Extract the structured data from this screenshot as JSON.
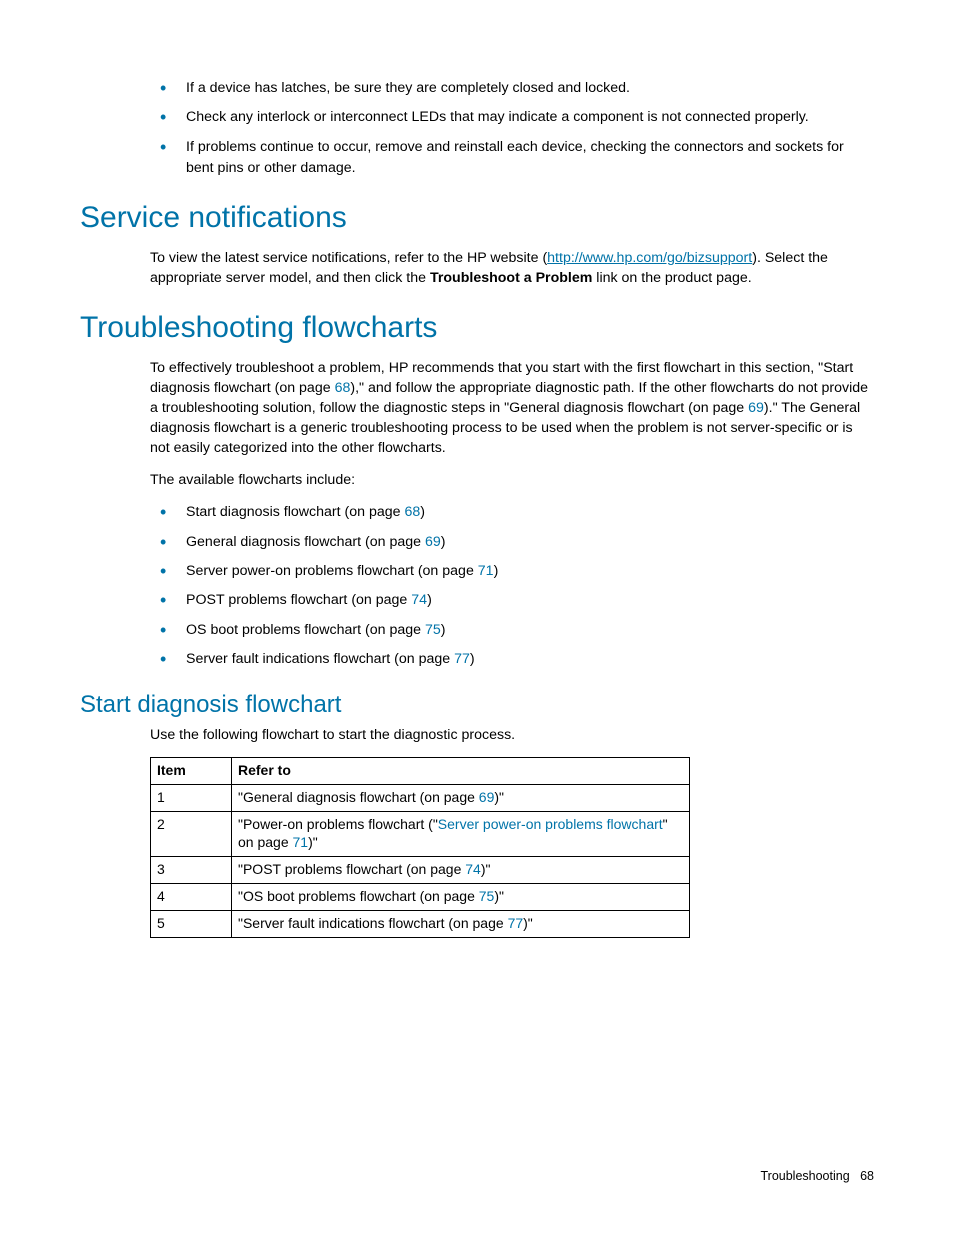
{
  "topBullets": [
    "If a device has latches, be sure they are completely closed and locked.",
    "Check any interlock or interconnect LEDs that may indicate a component is not connected properly.",
    "If problems continue to occur, remove and reinstall each device, checking the connectors and sockets for bent pins or other damage."
  ],
  "h1_service": "Service notifications",
  "service": {
    "pre": "To view the latest service notifications, refer to the HP website (",
    "link": "http://www.hp.com/go/bizsupport",
    "post1": "). Select the appropriate server model, and then click the ",
    "bold": "Troubleshoot a Problem",
    "post2": " link on the product page."
  },
  "h1_flow": "Troubleshooting flowcharts",
  "flow_intro": {
    "a": "To effectively troubleshoot a problem, HP recommends that you start with the first flowchart in this section, \"Start diagnosis flowchart (on page ",
    "p68": "68",
    "b": "),\" and follow the appropriate diagnostic path. If the other flowcharts do not provide a troubleshooting solution, follow the diagnostic steps in \"General diagnosis flowchart (on page ",
    "p69": "69",
    "c": ").\" The General diagnosis flowchart is a generic troubleshooting process to be used when the problem is not server-specific or is not easily categorized into the other flowcharts."
  },
  "flow_list_intro": "The available flowcharts include:",
  "flowList": [
    {
      "pre": "Start diagnosis flowchart (on page ",
      "page": "68",
      "post": ")"
    },
    {
      "pre": "General diagnosis flowchart (on page ",
      "page": "69",
      "post": ")"
    },
    {
      "pre": "Server power-on problems flowchart (on page ",
      "page": "71",
      "post": ")"
    },
    {
      "pre": "POST problems flowchart (on page ",
      "page": "74",
      "post": ")"
    },
    {
      "pre": "OS boot problems flowchart (on page ",
      "page": "75",
      "post": ")"
    },
    {
      "pre": "Server fault indications flowchart (on page ",
      "page": "77",
      "post": ")"
    }
  ],
  "h2_start": "Start diagnosis flowchart",
  "start_intro": "Use the following flowchart to start the diagnostic process.",
  "table": {
    "hItem": "Item",
    "hRefer": "Refer to",
    "rows": [
      {
        "n": "1",
        "a": "\"General diagnosis flowchart (on page ",
        "link": "69",
        "b": ")\""
      },
      {
        "n": "2",
        "a": "\"Power-on problems flowchart (\"",
        "link": "Server power-on problems flowchart",
        "mid": "\" on page ",
        "link2": "71",
        "b": ")\""
      },
      {
        "n": "3",
        "a": "\"POST problems flowchart (on page ",
        "link": "74",
        "b": ")\""
      },
      {
        "n": "4",
        "a": "\"OS boot problems flowchart (on page ",
        "link": "75",
        "b": ")\""
      },
      {
        "n": "5",
        "a": "\"Server fault indications flowchart (on page ",
        "link": "77",
        "b": ")\""
      }
    ]
  },
  "footer": {
    "section": "Troubleshooting",
    "page": "68"
  }
}
